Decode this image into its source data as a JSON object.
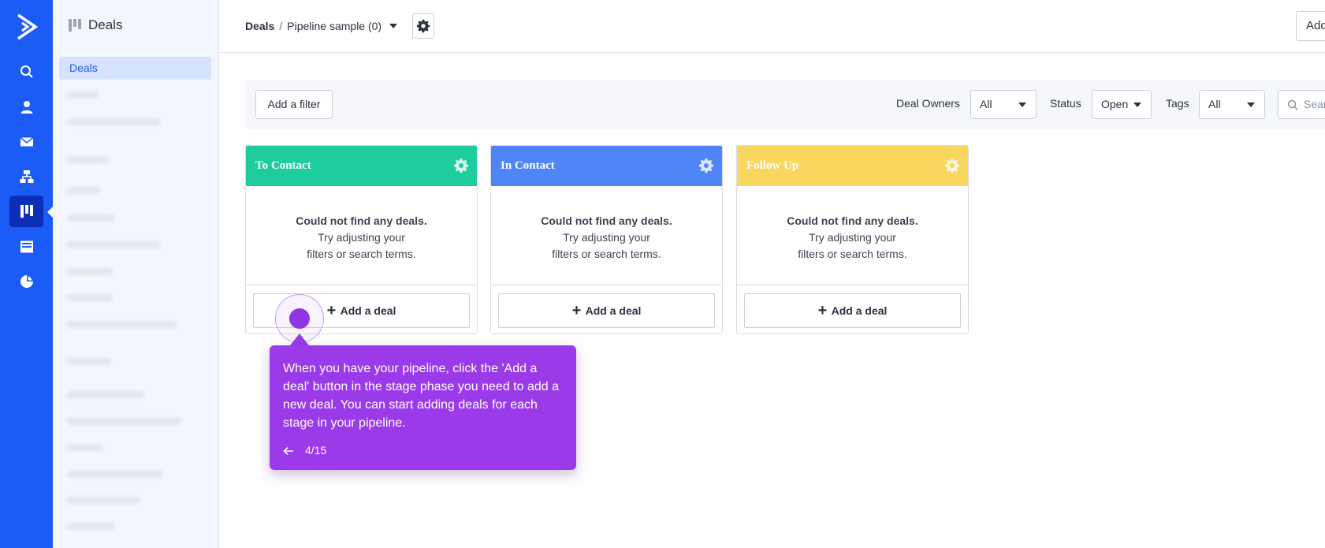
{
  "rail": {
    "logo": "activecampaign-chevron-logo",
    "items": [
      {
        "icon": "search-icon"
      },
      {
        "icon": "contacts-icon"
      },
      {
        "icon": "email-icon"
      },
      {
        "icon": "automations-icon"
      },
      {
        "icon": "deals-icon",
        "active": true
      },
      {
        "icon": "site-icon"
      },
      {
        "icon": "reports-icon"
      }
    ]
  },
  "sidebar": {
    "title": "Deals",
    "active_item": "Deals"
  },
  "header": {
    "breadcrumb_root": "Deals",
    "breadcrumb_sep": "/",
    "pipeline_name": "Pipeline sample (0)",
    "add_button": "Add"
  },
  "filters": {
    "add_filter": "Add a filter",
    "deal_owners_label": "Deal Owners",
    "deal_owners_value": "All",
    "status_label": "Status",
    "status_value": "Open",
    "tags_label": "Tags",
    "tags_value": "All",
    "search_placeholder": "Search"
  },
  "stages": [
    {
      "name": "To Contact",
      "color": "#1fcc9e",
      "empty_title": "Could not find any deals.",
      "empty_line1": "Try adjusting your",
      "empty_line2": "filters or search terms.",
      "add_label": "Add a deal"
    },
    {
      "name": "In Contact",
      "color": "#4f86f7",
      "empty_title": "Could not find any deals.",
      "empty_line1": "Try adjusting your",
      "empty_line2": "filters or search terms.",
      "add_label": "Add a deal"
    },
    {
      "name": "Follow Up",
      "color": "#f9d65e",
      "empty_title": "Could not find any deals.",
      "empty_line1": "Try adjusting your",
      "empty_line2": "filters or search terms.",
      "add_label": "Add a deal"
    }
  ],
  "guide": {
    "text": "When you have your pipeline, click the 'Add a deal' button in the stage phase you need to add a new deal. You can start adding deals for each stage in your pipeline.",
    "step": "4/15",
    "accent": "#9b3ae8"
  }
}
